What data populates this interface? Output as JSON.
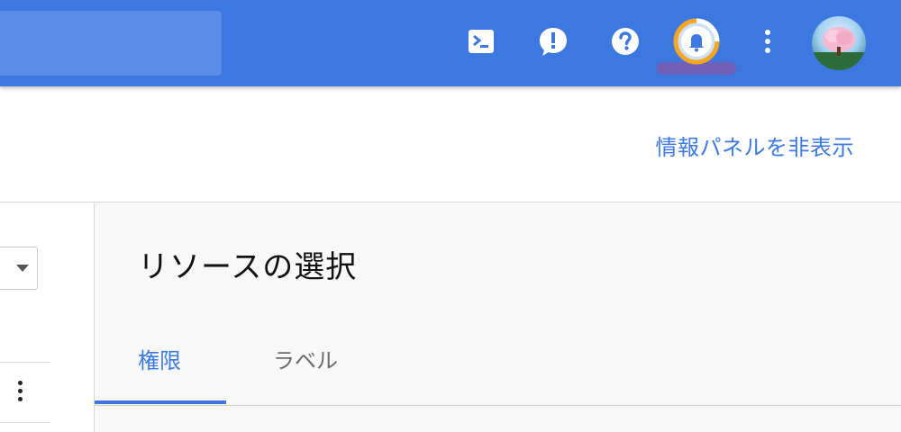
{
  "header": {
    "icons": [
      "cloud-shell-icon",
      "feedback-icon",
      "help-icon",
      "notifications-icon",
      "more-vert-icon",
      "avatar"
    ]
  },
  "info_panel": {
    "hide_link": "情報パネルを非表示",
    "title": "リソースの選択",
    "tabs": [
      {
        "label": "権限",
        "active": true
      },
      {
        "label": "ラベル",
        "active": false
      }
    ]
  },
  "colors": {
    "accent": "#3c78e0",
    "topbar": "#3c78e0",
    "notif_ring": "#f5a623"
  }
}
